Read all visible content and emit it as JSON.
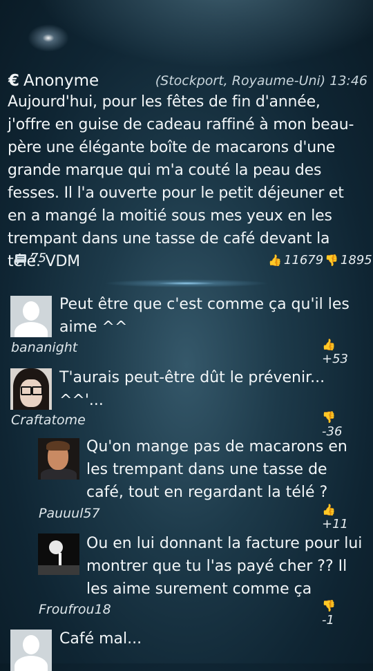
{
  "post": {
    "currency_symbol": "€",
    "author": "Anonyme",
    "location_time": "(Stockport, Royaume-Uni) 13:46",
    "body": "Aujourd'hui, pour les fêtes de fin d'année, j'offre en guise de cadeau raffiné à mon beau-père une élégante boîte de macarons d'une grande marque qui m'a couté la peau des fesses. Il l'a ouverte pour le petit déjeuner et en a mangé la moitié sous mes yeux en les trempant dans une tasse de café devant la télé. VDM",
    "comments_count": "75",
    "likes": "11679",
    "dislikes": "1895"
  },
  "comments": [
    {
      "text": "Peut être que c'est comme ça qu'il les aime ^^",
      "author": "bananight",
      "score": "+53",
      "vote": "up",
      "avatar": "default-avatar"
    },
    {
      "text": "T'aurais peut-être dût le prévenir... ^^'...",
      "author": "Craftatome",
      "score": "-36",
      "vote": "down",
      "avatar": "glasses-avatar"
    },
    {
      "text": "Qu'on mange pas de macarons en les trempant dans une tasse de café, tout en regardant la télé ?",
      "author": "Pauuul57",
      "score": "+11",
      "vote": "up",
      "avatar": "guy-avatar"
    },
    {
      "text": "Ou en lui donnant la facture pour lui montrer que tu l'as payé cher ?? Il les aime surement comme ça",
      "author": "Froufrou18",
      "score": "-1",
      "vote": "down",
      "avatar": "moon-avatar"
    },
    {
      "text": "Café mal...",
      "author": "",
      "score": "",
      "vote": "",
      "avatar": "default-avatar"
    }
  ]
}
